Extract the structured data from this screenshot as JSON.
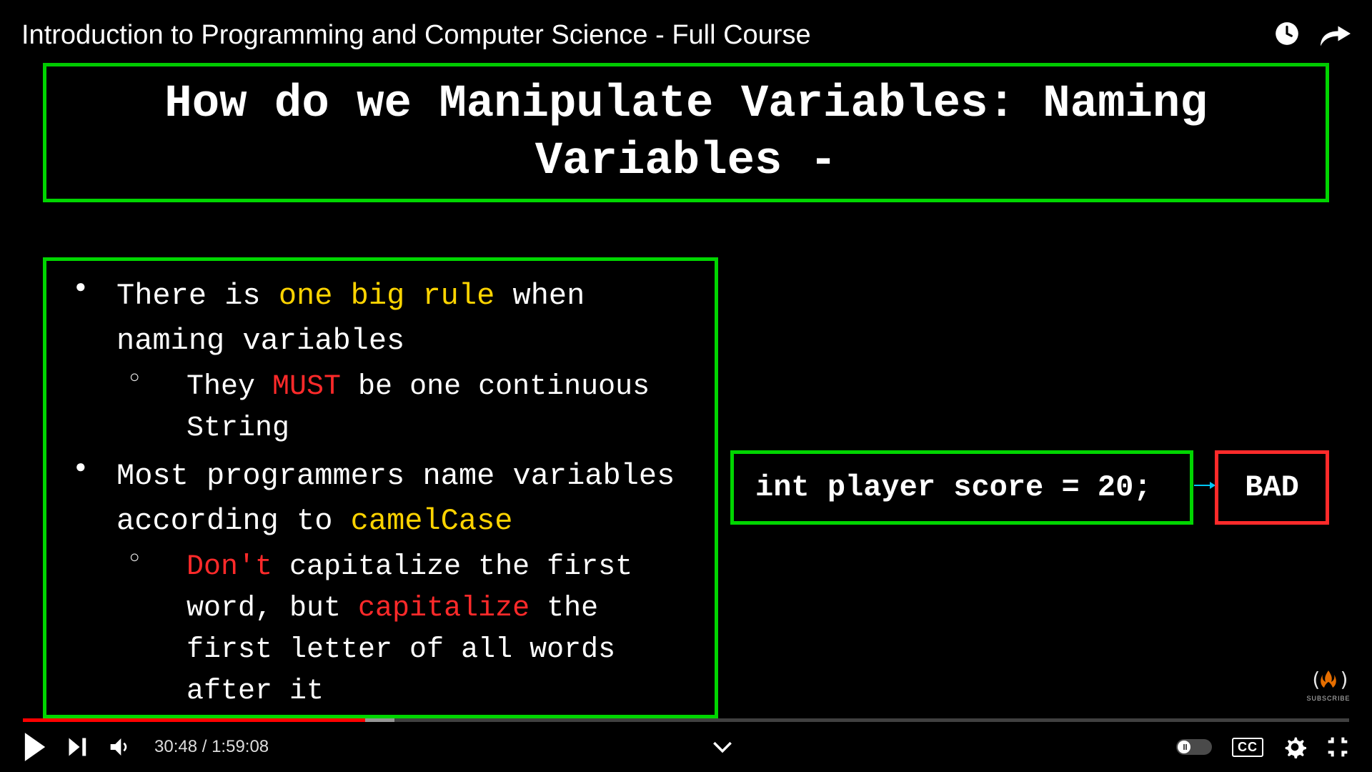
{
  "video": {
    "title": "Introduction to Programming and Computer Science - Full Course",
    "current_time": "30:48",
    "duration": "1:59:08",
    "played_pct": 25.8
  },
  "slide": {
    "title": "How do we Manipulate Variables: Naming Variables -",
    "bullets": [
      {
        "parts": [
          {
            "t": "There is ",
            "c": ""
          },
          {
            "t": "one big rule",
            "c": "hl-yellow"
          },
          {
            "t": " when naming variables",
            "c": ""
          }
        ],
        "sub": [
          {
            "parts": [
              {
                "t": "They ",
                "c": ""
              },
              {
                "t": "MUST",
                "c": "hl-red"
              },
              {
                "t": " be one continuous String",
                "c": ""
              }
            ]
          }
        ]
      },
      {
        "parts": [
          {
            "t": "Most programmers name variables according to ",
            "c": ""
          },
          {
            "t": "camelCase",
            "c": "hl-yellow"
          }
        ],
        "sub": [
          {
            "parts": [
              {
                "t": "Don't",
                "c": "hl-red"
              },
              {
                "t": " capitalize the first word, but ",
                "c": ""
              },
              {
                "t": "capitalize",
                "c": "hl-red"
              },
              {
                "t": " the first letter of all words after it",
                "c": ""
              }
            ]
          }
        ]
      }
    ],
    "code_example": "int player score = 20;",
    "bad_label": "BAD"
  },
  "watermark": {
    "subscribe": "SUBSCRIBE"
  },
  "controls": {
    "cc": "CC"
  }
}
